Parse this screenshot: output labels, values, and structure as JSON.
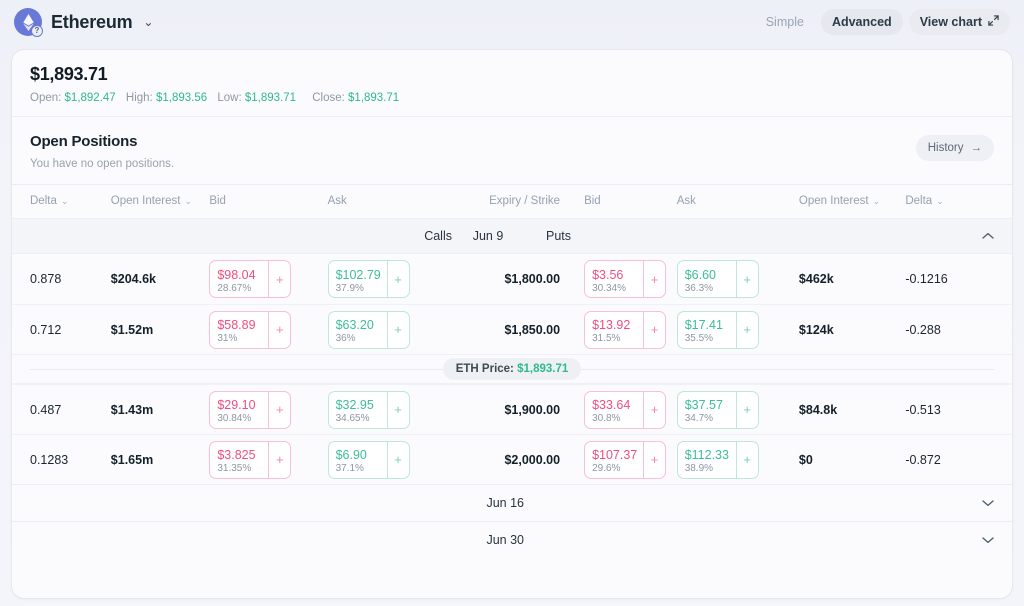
{
  "topbar": {
    "asset_name": "Ethereum",
    "asset_chevron": "⌄",
    "logo_icon": "ethereum-logo-icon",
    "modes": [
      {
        "label": "Simple",
        "active": false
      },
      {
        "label": "Advanced",
        "active": true
      }
    ],
    "view_chart_label": "View chart",
    "view_chart_icon": "↗"
  },
  "price": {
    "value": "$1,893.71",
    "open_label": "Open:",
    "open_value": "$1,892.47",
    "high_label": "High:",
    "high_value": "$1,893.56",
    "low_label": "Low:",
    "low_value": "$1,893.71",
    "close_label": "Close:",
    "close_value": "$1,893.71"
  },
  "positions": {
    "title": "Open Positions",
    "subtitle": "You have no open positions.",
    "history_label": "History",
    "history_icon": "→"
  },
  "table": {
    "headers": {
      "delta_left": "Delta",
      "open_interest_left": "Open Interest",
      "bid_left": "Bid",
      "ask_left": "Ask",
      "expiry_strike": "Expiry / Strike",
      "bid_right": "Bid",
      "ask_right": "Ask",
      "open_interest_right": "Open Interest",
      "delta_right": "Delta"
    },
    "group": {
      "calls_label": "Calls",
      "expiry_label": "Jun 9",
      "puts_label": "Puts",
      "collapse_icon": "⌃"
    },
    "rows": [
      {
        "call_delta": "0.878",
        "call_oi": "$204.6k",
        "call_bid_price": "$98.04",
        "call_bid_iv": "28.67%",
        "call_ask_price": "$102.79",
        "call_ask_iv": "37.9%",
        "strike": "$1,800.00",
        "put_bid_price": "$3.56",
        "put_bid_iv": "30.34%",
        "put_ask_price": "$6.60",
        "put_ask_iv": "36.3%",
        "put_oi": "$462k",
        "put_delta": "-0.1216"
      },
      {
        "call_delta": "0.712",
        "call_oi": "$1.52m",
        "call_bid_price": "$58.89",
        "call_bid_iv": "31%",
        "call_ask_price": "$63.20",
        "call_ask_iv": "36%",
        "strike": "$1,850.00",
        "put_bid_price": "$13.92",
        "put_bid_iv": "31.5%",
        "put_ask_price": "$17.41",
        "put_ask_iv": "35.5%",
        "put_oi": "$124k",
        "put_delta": "-0.288"
      },
      {
        "call_delta": "0.487",
        "call_oi": "$1.43m",
        "call_bid_price": "$29.10",
        "call_bid_iv": "30.84%",
        "call_ask_price": "$32.95",
        "call_ask_iv": "34.65%",
        "strike": "$1,900.00",
        "put_bid_price": "$33.64",
        "put_bid_iv": "30.8%",
        "put_ask_price": "$37.57",
        "put_ask_iv": "34.7%",
        "put_oi": "$84.8k",
        "put_delta": "-0.513"
      },
      {
        "call_delta": "0.1283",
        "call_oi": "$1.65m",
        "call_bid_price": "$3.825",
        "call_bid_iv": "31.35%",
        "call_ask_price": "$6.90",
        "call_ask_iv": "37.1%",
        "strike": "$2,000.00",
        "put_bid_price": "$107.37",
        "put_bid_iv": "29.6%",
        "put_ask_price": "$112.33",
        "put_ask_iv": "38.9%",
        "put_oi": "$0",
        "put_delta": "-0.872"
      }
    ],
    "spot_marker": {
      "label": "ETH Price:",
      "value": "$1,893.71",
      "after_row_index": 1
    },
    "collapsed_expiries": [
      {
        "label": "Jun 16",
        "expand_icon": "⌄"
      },
      {
        "label": "Jun 30",
        "expand_icon": "⌄"
      }
    ],
    "add_icon": "+",
    "sort_icon": "⌄"
  },
  "colors": {
    "bid": "#f24d7f",
    "ask": "#3dbd98",
    "positive": "#2fb98d",
    "brand": "#6979d8"
  }
}
